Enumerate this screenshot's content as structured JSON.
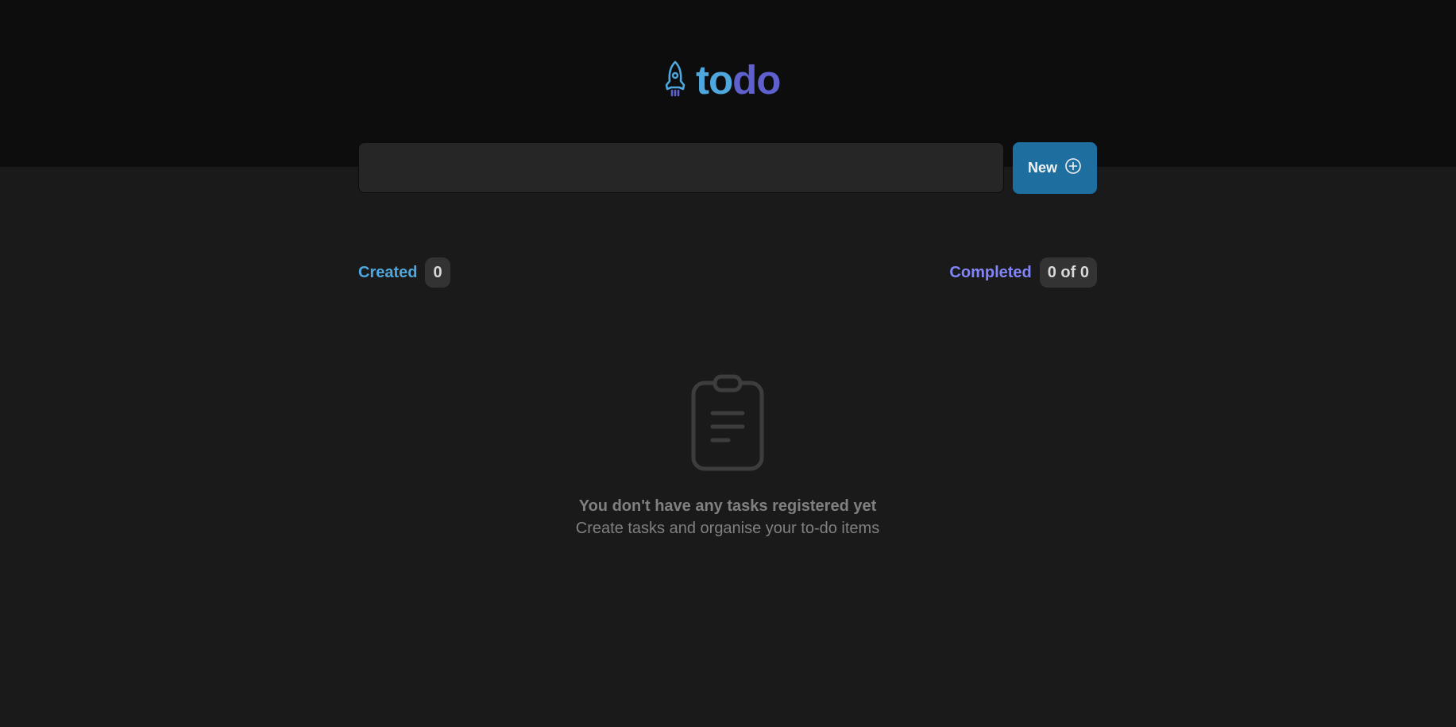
{
  "app": {
    "logo_icon": "rocket-icon",
    "logo_part1": "to",
    "logo_part2": "do"
  },
  "new_task": {
    "input_value": "",
    "input_placeholder": "",
    "button_label": "New",
    "button_icon": "plus-circle-icon"
  },
  "counters": {
    "created_label": "Created",
    "created_count": "0",
    "completed_label": "Completed",
    "completed_count": "0 of 0"
  },
  "empty_state": {
    "icon": "clipboard-icon",
    "title": "You don't have any tasks registered yet",
    "subtitle": "Create tasks and organise your to-do items"
  },
  "colors": {
    "header_bg": "#0d0d0d",
    "page_bg": "#1a1a1a",
    "blue": "#4ea8de",
    "purple_dark": "#5e60ce",
    "purple": "#8284fa",
    "button_bg": "#1e6f9f",
    "badge_bg": "#333333",
    "muted_text": "#808080"
  }
}
